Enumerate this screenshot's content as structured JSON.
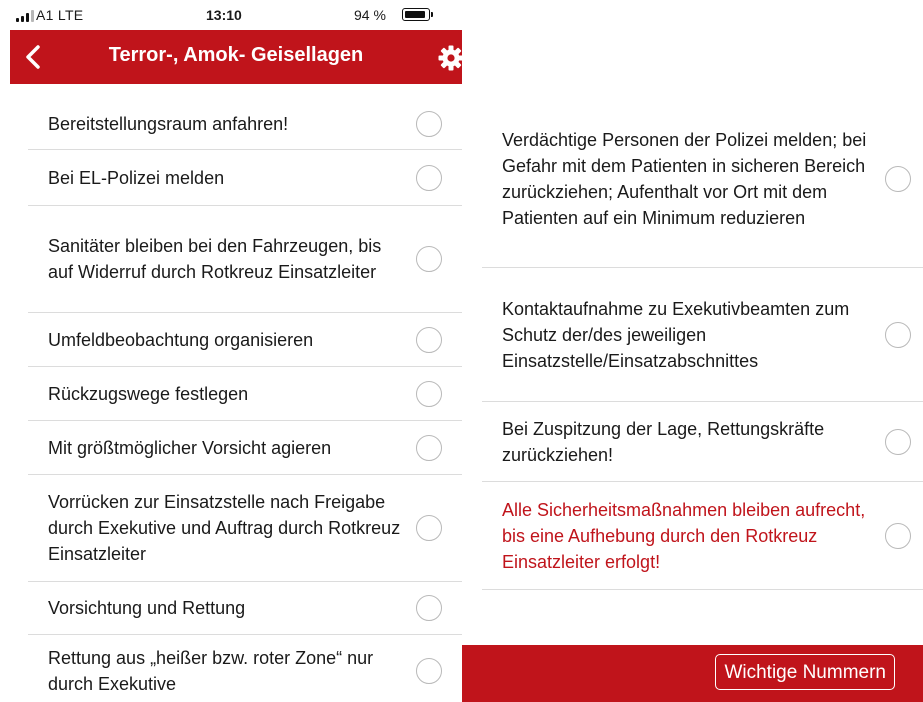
{
  "status_bar": {
    "carrier": "A1  LTE",
    "time": "13:10",
    "battery_percent_text": "94 %",
    "battery_level": 0.94
  },
  "header": {
    "title": "Terror-, Amok- Geisellagen",
    "back_icon": "chevron-left-icon",
    "settings_icon": "gear-icon",
    "background_color": "#c0141b"
  },
  "checklist_left": [
    {
      "text": "Bereitstellungsraum anfahren!",
      "checked": false
    },
    {
      "text": "Bei EL-Polizei melden",
      "checked": false
    },
    {
      "text": "Sanitäter bleiben bei den Fahrzeugen, bis auf Widerruf durch Rotkreuz Einsatzleiter",
      "checked": false
    },
    {
      "text": "Umfeldbeobachtung organisieren",
      "checked": false
    },
    {
      "text": "Rückzugswege festlegen",
      "checked": false
    },
    {
      "text": "Mit größtmöglicher Vorsicht agieren",
      "checked": false
    },
    {
      "text": "Vorrücken zur Einsatzstelle nach Freigabe durch Exekutive und Auftrag durch Rotkreuz Einsatzleiter",
      "checked": false
    },
    {
      "text": "Vorsichtung und Rettung",
      "checked": false
    },
    {
      "text": "Rettung aus „heißer bzw. roter Zone“ nur durch Exekutive",
      "checked": false
    }
  ],
  "checklist_right": [
    {
      "text": "Verdächtige Personen der Polizei melden; bei Gefahr mit dem Patienten in sicheren Bereich zurückziehen; Aufenthalt vor Ort mit dem Patienten auf ein Minimum reduzieren",
      "checked": false
    },
    {
      "text": "Kontaktaufnahme zu Exekutivbeamten zum Schutz der/des jeweiligen Einsatzstelle/Einsatzabschnittes",
      "checked": false
    },
    {
      "text": "Bei Zuspitzung der Lage, Rettungskräfte zurückziehen!",
      "checked": false
    },
    {
      "text": "Alle Sicherheitsmaßnahmen bleiben aufrecht, bis eine Aufhebung durch den Rotkreuz Einsatzleiter erfolgt!",
      "checked": false,
      "highlight_color": "#c0141b"
    }
  ],
  "footer": {
    "button_label": "Wichtige Nummern"
  }
}
